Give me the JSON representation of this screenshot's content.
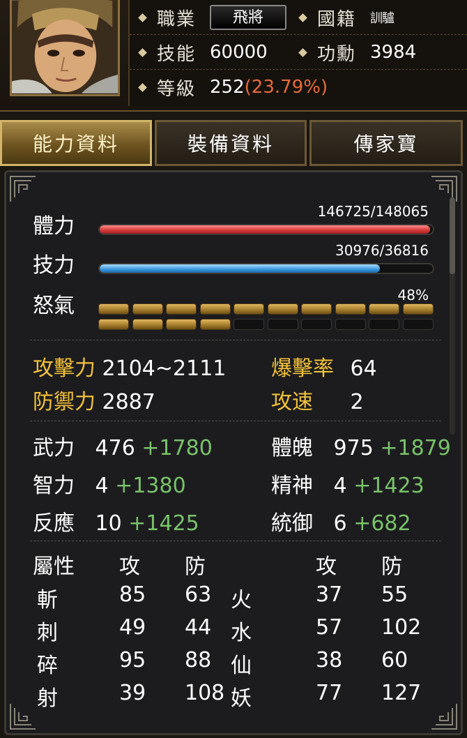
{
  "header": {
    "class_label": "職業",
    "class_value": "飛將",
    "nation_label": "國籍",
    "nation_value": "訓驢",
    "skill_label": "技能",
    "skill_value": "60000",
    "merit_label": "功勳",
    "merit_value": "3984",
    "level_label": "等級",
    "level_value": "252",
    "level_percent": "(23.79%)"
  },
  "tabs": [
    {
      "label": "能力資料",
      "active": true
    },
    {
      "label": "裝備資料",
      "active": false
    },
    {
      "label": "傳家寶",
      "active": false
    }
  ],
  "bars": {
    "hp": {
      "label": "體力",
      "text": "146725/148065",
      "current": 146725,
      "max": 148065
    },
    "sp": {
      "label": "技力",
      "text": "30976/36816",
      "current": 30976,
      "max": 36816
    },
    "rage": {
      "label": "怒氣",
      "text": "48%",
      "percent": 48,
      "segments_total": 20,
      "segments_filled": 14
    }
  },
  "combat": {
    "attack_label": "攻擊力",
    "attack_value": "2104~2111",
    "crit_label": "爆擊率",
    "crit_value": "64",
    "defense_label": "防禦力",
    "defense_value": "2887",
    "speed_label": "攻速",
    "speed_value": "2"
  },
  "attributes": [
    {
      "label": "武力",
      "base": "476",
      "bonus": "+1780"
    },
    {
      "label": "體魄",
      "base": "975",
      "bonus": "+1879"
    },
    {
      "label": "智力",
      "base": "4",
      "bonus": "+1380"
    },
    {
      "label": "精神",
      "base": "4",
      "bonus": "+1423"
    },
    {
      "label": "反應",
      "base": "10",
      "bonus": "+1425"
    },
    {
      "label": "統御",
      "base": "6",
      "bonus": "+682"
    }
  ],
  "elements": {
    "header_label": "屬性",
    "atk_header": "攻",
    "def_header": "防",
    "atk_header_2": "攻",
    "def_header_2": "防",
    "rows": [
      {
        "left": "斬",
        "left_atk": "85",
        "left_def": "63",
        "right": "火",
        "right_atk": "37",
        "right_def": "55"
      },
      {
        "left": "刺",
        "left_atk": "49",
        "left_def": "44",
        "right": "水",
        "right_atk": "57",
        "right_def": "102"
      },
      {
        "left": "碎",
        "left_atk": "95",
        "left_def": "88",
        "right": "仙",
        "right_atk": "38",
        "right_def": "60"
      },
      {
        "left": "射",
        "left_atk": "39",
        "left_def": "108",
        "right": "妖",
        "right_atk": "77",
        "right_def": "127"
      }
    ]
  },
  "colors": {
    "gold": "#f2c23a",
    "bonus_green": "#79c26a",
    "level_orange": "#e86a3c",
    "hp_red": "#d43a3a",
    "sp_blue": "#3a96dc"
  }
}
